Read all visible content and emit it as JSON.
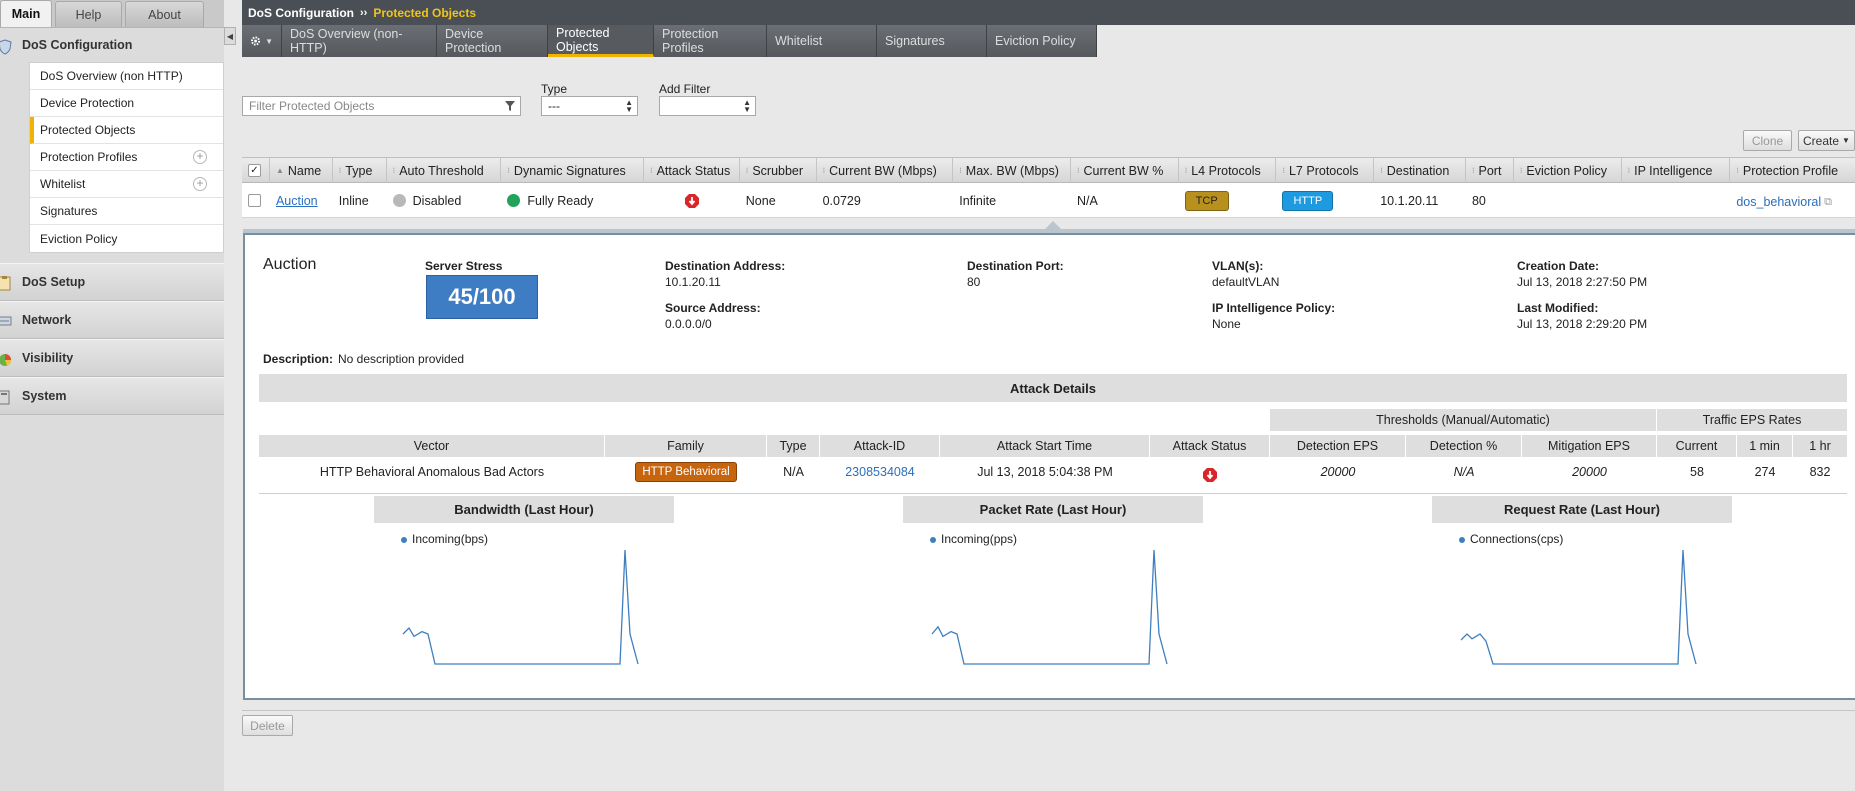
{
  "main_tabs": [
    "Main",
    "Help",
    "About"
  ],
  "sidebar": {
    "section_dos_config": "DoS Configuration",
    "sub_items": [
      {
        "label": "DoS Overview (non HTTP)"
      },
      {
        "label": "Device Protection"
      },
      {
        "label": "Protected Objects"
      },
      {
        "label": "Protection Profiles"
      },
      {
        "label": "Whitelist"
      },
      {
        "label": "Signatures"
      },
      {
        "label": "Eviction Policy"
      }
    ],
    "sections": [
      "DoS Setup",
      "Network",
      "Visibility",
      "System"
    ]
  },
  "breadcrumb": {
    "root": "DoS Configuration",
    "separator": "››",
    "current": "Protected Objects"
  },
  "tabs": [
    "DoS Overview (non-HTTP)",
    "Device Protection",
    "Protected Objects",
    "Protection Profiles",
    "Whitelist",
    "Signatures",
    "Eviction Policy"
  ],
  "filters": {
    "search_placeholder": "Filter Protected Objects",
    "type_label": "Type",
    "type_value": "---",
    "add_filter_label": "Add Filter",
    "add_filter_value": ""
  },
  "buttons": {
    "clone": "Clone",
    "create": "Create",
    "delete": "Delete"
  },
  "table": {
    "columns": [
      "Name",
      "Type",
      "Auto Threshold",
      "Dynamic Signatures",
      "Attack Status",
      "Scrubber",
      "Current BW (Mbps)",
      "Max. BW (Mbps)",
      "Current BW %",
      "L4 Protocols",
      "L7 Protocols",
      "Destination",
      "Port",
      "Eviction Policy",
      "IP Intelligence",
      "Protection Profile"
    ],
    "row": {
      "name": "Auction",
      "type": "Inline",
      "auto_threshold": "Disabled",
      "dynamic_signatures": "Fully Ready",
      "scrubber": "None",
      "current_bw": "0.0729",
      "max_bw": "Infinite",
      "current_bw_pct": "N/A",
      "l4": "TCP",
      "l7": "HTTP",
      "destination": "10.1.20.11",
      "port": "80",
      "eviction_policy": "",
      "ip_intelligence": "",
      "protection_profile": "dos_behavioral"
    }
  },
  "details": {
    "name": "Auction",
    "server_stress_label": "Server Stress",
    "server_stress_value": "45/100",
    "dest_addr_label": "Destination Address:",
    "dest_addr": "10.1.20.11",
    "src_addr_label": "Source Address:",
    "src_addr": "0.0.0.0/0",
    "dest_port_label": "Destination Port:",
    "dest_port": "80",
    "vlan_label": "VLAN(s):",
    "vlan": "defaultVLAN",
    "ipi_label": "IP Intelligence Policy:",
    "ipi": "None",
    "created_label": "Creation Date:",
    "created": "Jul 13, 2018 2:27:50 PM",
    "modified_label": "Last Modified:",
    "modified": "Jul 13, 2018 2:29:20 PM",
    "description_label": "Description:",
    "description": "No description provided"
  },
  "attack": {
    "title": "Attack Details",
    "thresholds_group": "Thresholds (Manual/Automatic)",
    "traffic_group": "Traffic EPS Rates",
    "columns": [
      "Vector",
      "Family",
      "Type",
      "Attack-ID",
      "Attack Start Time",
      "Attack Status",
      "Detection EPS",
      "Detection %",
      "Mitigation EPS",
      "Current",
      "1 min",
      "1 hr"
    ],
    "row": {
      "vector": "HTTP Behavioral Anomalous Bad Actors",
      "family": "HTTP Behavioral",
      "type": "N/A",
      "attack_id": "2308534084",
      "start_time": "Jul 13, 2018 5:04:38 PM",
      "detection_eps": "20000",
      "detection_pct": "N/A",
      "mitigation_eps": "20000",
      "current": "58",
      "one_min": "274",
      "one_hr": "832"
    }
  },
  "colors": {
    "accent": "#f0b400",
    "tcp_badge": "#b8901e",
    "http_badge": "#1e9be0",
    "family_badge": "#c7640e",
    "link": "#2a6fbd",
    "line": "#3f7fc0"
  },
  "chart_data": [
    {
      "type": "line",
      "title": "Bandwidth (Last Hour)",
      "series": [
        {
          "name": "Incoming(bps)",
          "values": [
            0.3,
            0.35,
            0.28,
            0.32,
            0.3,
            0.05,
            0.05,
            0.05,
            0.05,
            0.05,
            0.05,
            0.05,
            0.05,
            0.05,
            0.05,
            0.05,
            1.0,
            0.3,
            0.05
          ]
        }
      ]
    },
    {
      "type": "line",
      "title": "Packet Rate (Last Hour)",
      "series": [
        {
          "name": "Incoming(pps)",
          "values": [
            0.3,
            0.36,
            0.28,
            0.32,
            0.3,
            0.05,
            0.05,
            0.05,
            0.05,
            0.05,
            0.05,
            0.05,
            0.05,
            0.05,
            0.05,
            0.05,
            1.0,
            0.3,
            0.05
          ]
        }
      ]
    },
    {
      "type": "line",
      "title": "Request Rate (Last Hour)",
      "series": [
        {
          "name": "Connections(cps)",
          "values": [
            0.25,
            0.3,
            0.26,
            0.3,
            0.24,
            0.05,
            0.05,
            0.05,
            0.05,
            0.05,
            0.05,
            0.05,
            0.05,
            0.05,
            0.05,
            0.05,
            1.0,
            0.3,
            0.05
          ]
        }
      ]
    }
  ]
}
